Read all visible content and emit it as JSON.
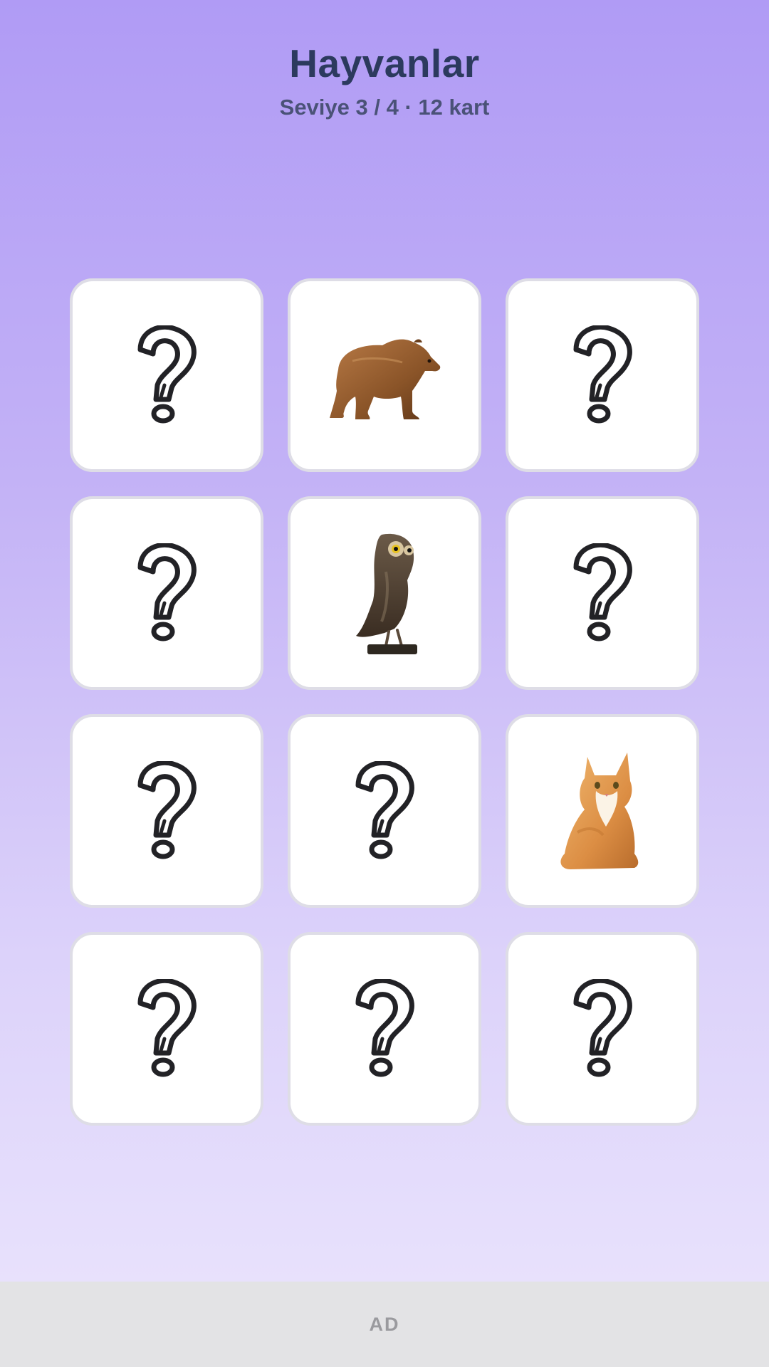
{
  "header": {
    "title": "Hayvanlar",
    "subtitle": "Seviye 3 / 4 · 12 kart"
  },
  "board": {
    "columns": 3,
    "rows": 4,
    "cards": [
      {
        "state": "hidden",
        "icon": "question-mark-icon"
      },
      {
        "state": "revealed",
        "icon": "bear-icon"
      },
      {
        "state": "hidden",
        "icon": "question-mark-icon"
      },
      {
        "state": "hidden",
        "icon": "question-mark-icon"
      },
      {
        "state": "revealed",
        "icon": "owl-icon"
      },
      {
        "state": "hidden",
        "icon": "question-mark-icon"
      },
      {
        "state": "hidden",
        "icon": "question-mark-icon"
      },
      {
        "state": "hidden",
        "icon": "question-mark-icon"
      },
      {
        "state": "revealed",
        "icon": "cat-icon"
      },
      {
        "state": "hidden",
        "icon": "question-mark-icon"
      },
      {
        "state": "hidden",
        "icon": "question-mark-icon"
      },
      {
        "state": "hidden",
        "icon": "question-mark-icon"
      }
    ]
  },
  "ad": {
    "label": "AD"
  },
  "colors": {
    "title": "#2c3a5e",
    "subtitle": "#4a5277",
    "card_background": "#ffffff",
    "card_border": "#dedde6",
    "background_top": "#b09bf5",
    "background_bottom": "#ebe5fd",
    "ad_background": "#e3e3e5"
  }
}
